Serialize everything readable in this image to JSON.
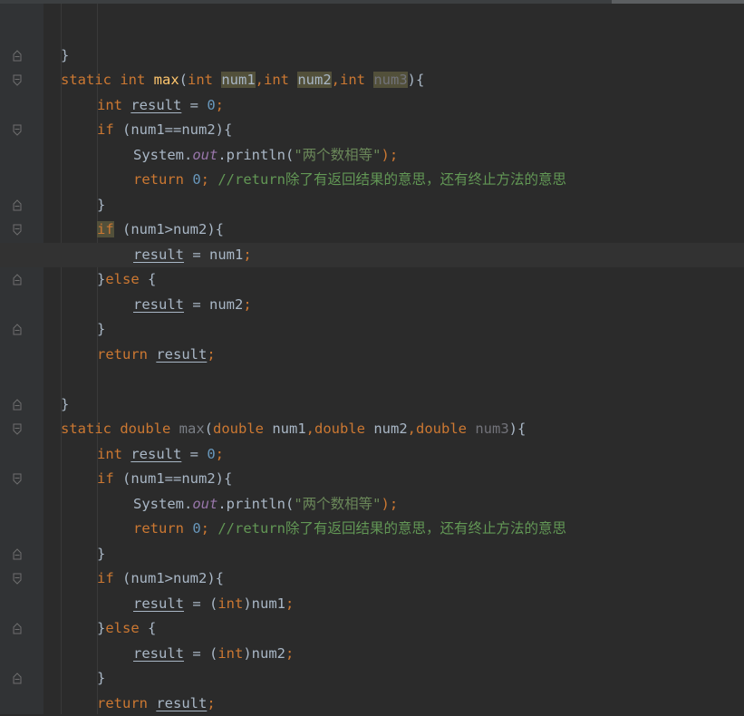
{
  "editor": {
    "colors": {
      "background": "#2b2b2b",
      "keyword": "#cc7832",
      "method": "#ffc66d",
      "number": "#6897bb",
      "string": "#6a8759",
      "comment": "#629755",
      "field": "#9876aa",
      "text": "#a9b7c6"
    },
    "fold_icon": "fold-marker-icon",
    "lines": [
      {
        "indent": 0,
        "fold": "",
        "tokens": []
      },
      {
        "indent": 0,
        "fold": "end",
        "tokens": [
          {
            "t": "}",
            "c": "p"
          }
        ]
      },
      {
        "indent": 0,
        "fold": "start",
        "tokens": [
          {
            "t": "static ",
            "c": "kw"
          },
          {
            "t": "int ",
            "c": "kw"
          },
          {
            "t": "max",
            "c": "fn"
          },
          {
            "t": "(",
            "c": "p"
          },
          {
            "t": "int ",
            "c": "kw"
          },
          {
            "t": "num1",
            "c": "hl"
          },
          {
            "t": ",",
            "c": "semi"
          },
          {
            "t": "int ",
            "c": "kw"
          },
          {
            "t": "num2",
            "c": "hl"
          },
          {
            "t": ",",
            "c": "semi"
          },
          {
            "t": "int ",
            "c": "kw"
          },
          {
            "t": "num3",
            "c": "hldim"
          },
          {
            "t": "){",
            "c": "p"
          }
        ]
      },
      {
        "indent": 1,
        "fold": "",
        "tokens": [
          {
            "t": "int ",
            "c": "kw"
          },
          {
            "t": "result",
            "c": "ul"
          },
          {
            "t": " = ",
            "c": "p"
          },
          {
            "t": "0",
            "c": "num"
          },
          {
            "t": ";",
            "c": "semi"
          }
        ]
      },
      {
        "indent": 1,
        "fold": "start",
        "tokens": [
          {
            "t": "if ",
            "c": "kw"
          },
          {
            "t": "(num1==num2){",
            "c": "p"
          }
        ]
      },
      {
        "indent": 2,
        "fold": "",
        "tokens": [
          {
            "t": "System.",
            "c": "p"
          },
          {
            "t": "out",
            "c": "field"
          },
          {
            "t": ".println(",
            "c": "p"
          },
          {
            "t": "\"两个数相等\"",
            "c": "str"
          },
          {
            "t": ");",
            "c": "semi"
          }
        ]
      },
      {
        "indent": 2,
        "fold": "",
        "tokens": [
          {
            "t": "return ",
            "c": "kw"
          },
          {
            "t": "0",
            "c": "num"
          },
          {
            "t": "; ",
            "c": "semi"
          },
          {
            "t": "//return除了有返回结果的意思，还有终止方法的意思",
            "c": "cmt"
          }
        ]
      },
      {
        "indent": 1,
        "fold": "end",
        "tokens": [
          {
            "t": "}",
            "c": "p"
          }
        ]
      },
      {
        "indent": 1,
        "fold": "start",
        "tokens": [
          {
            "t": "if",
            "c": "kwhl"
          },
          {
            "t": " (num1>num2){",
            "c": "p"
          }
        ]
      },
      {
        "indent": 2,
        "fold": "",
        "current": true,
        "tokens": [
          {
            "t": "result",
            "c": "ul"
          },
          {
            "t": " = num1",
            "c": "p"
          },
          {
            "t": ";",
            "c": "semi"
          }
        ]
      },
      {
        "indent": 1,
        "fold": "end",
        "tokens": [
          {
            "t": "}",
            "c": "p"
          },
          {
            "t": "else ",
            "c": "kw"
          },
          {
            "t": "{",
            "c": "p"
          }
        ]
      },
      {
        "indent": 2,
        "fold": "",
        "tokens": [
          {
            "t": "result",
            "c": "ul"
          },
          {
            "t": " = num2",
            "c": "p"
          },
          {
            "t": ";",
            "c": "semi"
          }
        ]
      },
      {
        "indent": 1,
        "fold": "end",
        "tokens": [
          {
            "t": "}",
            "c": "p"
          }
        ]
      },
      {
        "indent": 1,
        "fold": "",
        "tokens": [
          {
            "t": "return ",
            "c": "kw"
          },
          {
            "t": "result",
            "c": "ul"
          },
          {
            "t": ";",
            "c": "semi"
          }
        ]
      },
      {
        "indent": 0,
        "fold": "",
        "tokens": []
      },
      {
        "indent": 0,
        "fold": "end",
        "tokens": [
          {
            "t": "}",
            "c": "p"
          }
        ]
      },
      {
        "indent": 0,
        "fold": "start",
        "tokens": [
          {
            "t": "static ",
            "c": "kw"
          },
          {
            "t": "double ",
            "c": "kw"
          },
          {
            "t": "max",
            "c": "fndim"
          },
          {
            "t": "(",
            "c": "p"
          },
          {
            "t": "double ",
            "c": "kw"
          },
          {
            "t": "num1",
            "c": "p"
          },
          {
            "t": ",",
            "c": "semi"
          },
          {
            "t": "double ",
            "c": "kw"
          },
          {
            "t": "num2",
            "c": "p"
          },
          {
            "t": ",",
            "c": "semi"
          },
          {
            "t": "double ",
            "c": "kw"
          },
          {
            "t": "num3",
            "c": "dim"
          },
          {
            "t": "){",
            "c": "p"
          }
        ]
      },
      {
        "indent": 1,
        "fold": "",
        "tokens": [
          {
            "t": "int ",
            "c": "kw"
          },
          {
            "t": "result",
            "c": "ul"
          },
          {
            "t": " = ",
            "c": "p"
          },
          {
            "t": "0",
            "c": "num"
          },
          {
            "t": ";",
            "c": "semi"
          }
        ]
      },
      {
        "indent": 1,
        "fold": "start",
        "tokens": [
          {
            "t": "if ",
            "c": "kw"
          },
          {
            "t": "(num1==num2){",
            "c": "p"
          }
        ]
      },
      {
        "indent": 2,
        "fold": "",
        "tokens": [
          {
            "t": "System.",
            "c": "p"
          },
          {
            "t": "out",
            "c": "field"
          },
          {
            "t": ".println(",
            "c": "p"
          },
          {
            "t": "\"两个数相等\"",
            "c": "str"
          },
          {
            "t": ");",
            "c": "semi"
          }
        ]
      },
      {
        "indent": 2,
        "fold": "",
        "tokens": [
          {
            "t": "return ",
            "c": "kw"
          },
          {
            "t": "0",
            "c": "num"
          },
          {
            "t": "; ",
            "c": "semi"
          },
          {
            "t": "//return除了有返回结果的意思，还有终止方法的意思",
            "c": "cmt"
          }
        ]
      },
      {
        "indent": 1,
        "fold": "end",
        "tokens": [
          {
            "t": "}",
            "c": "p"
          }
        ]
      },
      {
        "indent": 1,
        "fold": "start",
        "tokens": [
          {
            "t": "if ",
            "c": "kw"
          },
          {
            "t": "(num1>num2){",
            "c": "p"
          }
        ]
      },
      {
        "indent": 2,
        "fold": "",
        "tokens": [
          {
            "t": "result",
            "c": "ul"
          },
          {
            "t": " = (",
            "c": "p"
          },
          {
            "t": "int",
            "c": "kw"
          },
          {
            "t": ")num1",
            "c": "p"
          },
          {
            "t": ";",
            "c": "semi"
          }
        ]
      },
      {
        "indent": 1,
        "fold": "end",
        "tokens": [
          {
            "t": "}",
            "c": "p"
          },
          {
            "t": "else ",
            "c": "kw"
          },
          {
            "t": "{",
            "c": "p"
          }
        ]
      },
      {
        "indent": 2,
        "fold": "",
        "tokens": [
          {
            "t": "result",
            "c": "ul"
          },
          {
            "t": " = (",
            "c": "p"
          },
          {
            "t": "int",
            "c": "kw"
          },
          {
            "t": ")num2",
            "c": "p"
          },
          {
            "t": ";",
            "c": "semi"
          }
        ]
      },
      {
        "indent": 1,
        "fold": "end",
        "tokens": [
          {
            "t": "}",
            "c": "p"
          }
        ]
      },
      {
        "indent": 1,
        "fold": "",
        "tokens": [
          {
            "t": "return ",
            "c": "kw"
          },
          {
            "t": "result",
            "c": "ul"
          },
          {
            "t": ";",
            "c": "semi"
          }
        ]
      }
    ]
  }
}
